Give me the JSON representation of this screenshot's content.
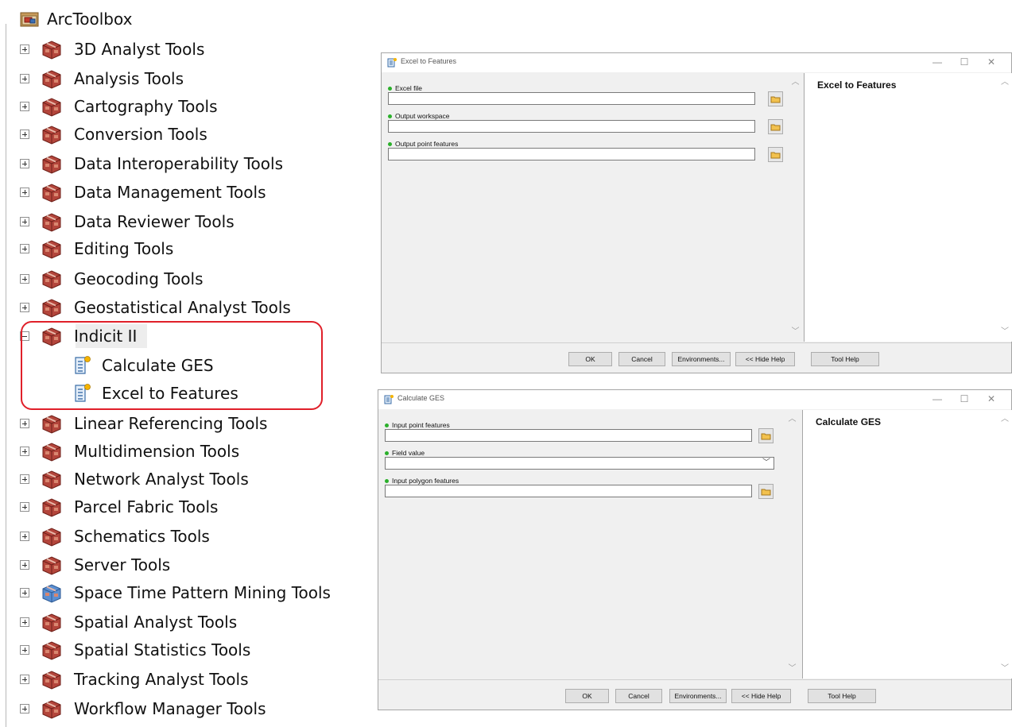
{
  "toolbox": {
    "root_label": "ArcToolbox",
    "items": [
      {
        "label": "3D Analyst Tools"
      },
      {
        "label": "Analysis Tools"
      },
      {
        "label": "Cartography Tools"
      },
      {
        "label": "Conversion Tools"
      },
      {
        "label": "Data Interoperability Tools"
      },
      {
        "label": "Data Management Tools"
      },
      {
        "label": "Data Reviewer Tools"
      },
      {
        "label": "Editing Tools"
      },
      {
        "label": "Geocoding Tools"
      },
      {
        "label": "Geostatistical Analyst Tools"
      },
      {
        "label": "Indicit II",
        "expanded": true,
        "children": [
          {
            "label": "Calculate GES"
          },
          {
            "label": "Excel to Features"
          }
        ]
      },
      {
        "label": "Linear Referencing Tools"
      },
      {
        "label": "Multidimension Tools"
      },
      {
        "label": "Network Analyst Tools"
      },
      {
        "label": "Parcel Fabric Tools"
      },
      {
        "label": "Schematics Tools"
      },
      {
        "label": "Server Tools"
      },
      {
        "label": "Space Time Pattern Mining Tools"
      },
      {
        "label": "Spatial Analyst Tools"
      },
      {
        "label": "Spatial Statistics Tools"
      },
      {
        "label": "Tracking Analyst Tools"
      },
      {
        "label": "Workflow Manager Tools"
      }
    ]
  },
  "dialogs": {
    "excel": {
      "title": "Excel to Features",
      "help_title": "Excel to Features",
      "params": [
        "Excel file",
        "Output workspace",
        "Output point features"
      ]
    },
    "ges": {
      "title": "Calculate GES",
      "help_title": "Calculate GES",
      "params": [
        "Input point features",
        "Field value",
        "Input polygon features"
      ]
    },
    "buttons": {
      "ok": "OK",
      "cancel": "Cancel",
      "environments": "Environments...",
      "hide_help": "<< Hide Help",
      "tool_help": "Tool Help"
    },
    "window_buttons": {
      "minimize": "—",
      "maximize": "☐",
      "close": "✕"
    }
  },
  "colors": {
    "highlight": "#e0202a",
    "required_dot": "#2bb02b"
  }
}
